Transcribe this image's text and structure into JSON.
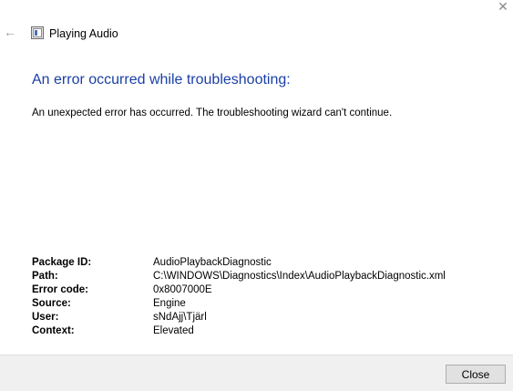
{
  "window": {
    "close_glyph": "✕",
    "back_glyph": "←",
    "app_title": "Playing Audio"
  },
  "main": {
    "heading": "An error occurred while troubleshooting:",
    "message": "An unexpected error has occurred. The troubleshooting wizard can't continue."
  },
  "details": [
    {
      "label": "Package ID:",
      "value": "AudioPlaybackDiagnostic"
    },
    {
      "label": "Path:",
      "value": "C:\\WINDOWS\\Diagnostics\\Index\\AudioPlaybackDiagnostic.xml"
    },
    {
      "label": "Error code:",
      "value": "0x8007000E"
    },
    {
      "label": "Source:",
      "value": "Engine"
    },
    {
      "label": "User:",
      "value": "sNdAjj\\Tjärl"
    },
    {
      "label": "Context:",
      "value": "Elevated"
    }
  ],
  "footer": {
    "close_label": "Close"
  },
  "colors": {
    "heading": "#1a3fa6",
    "footer_bg": "#f0f0f0"
  },
  "icons": {
    "app": "troubleshooter-app-icon",
    "back": "back-arrow-icon",
    "close": "close-icon"
  }
}
